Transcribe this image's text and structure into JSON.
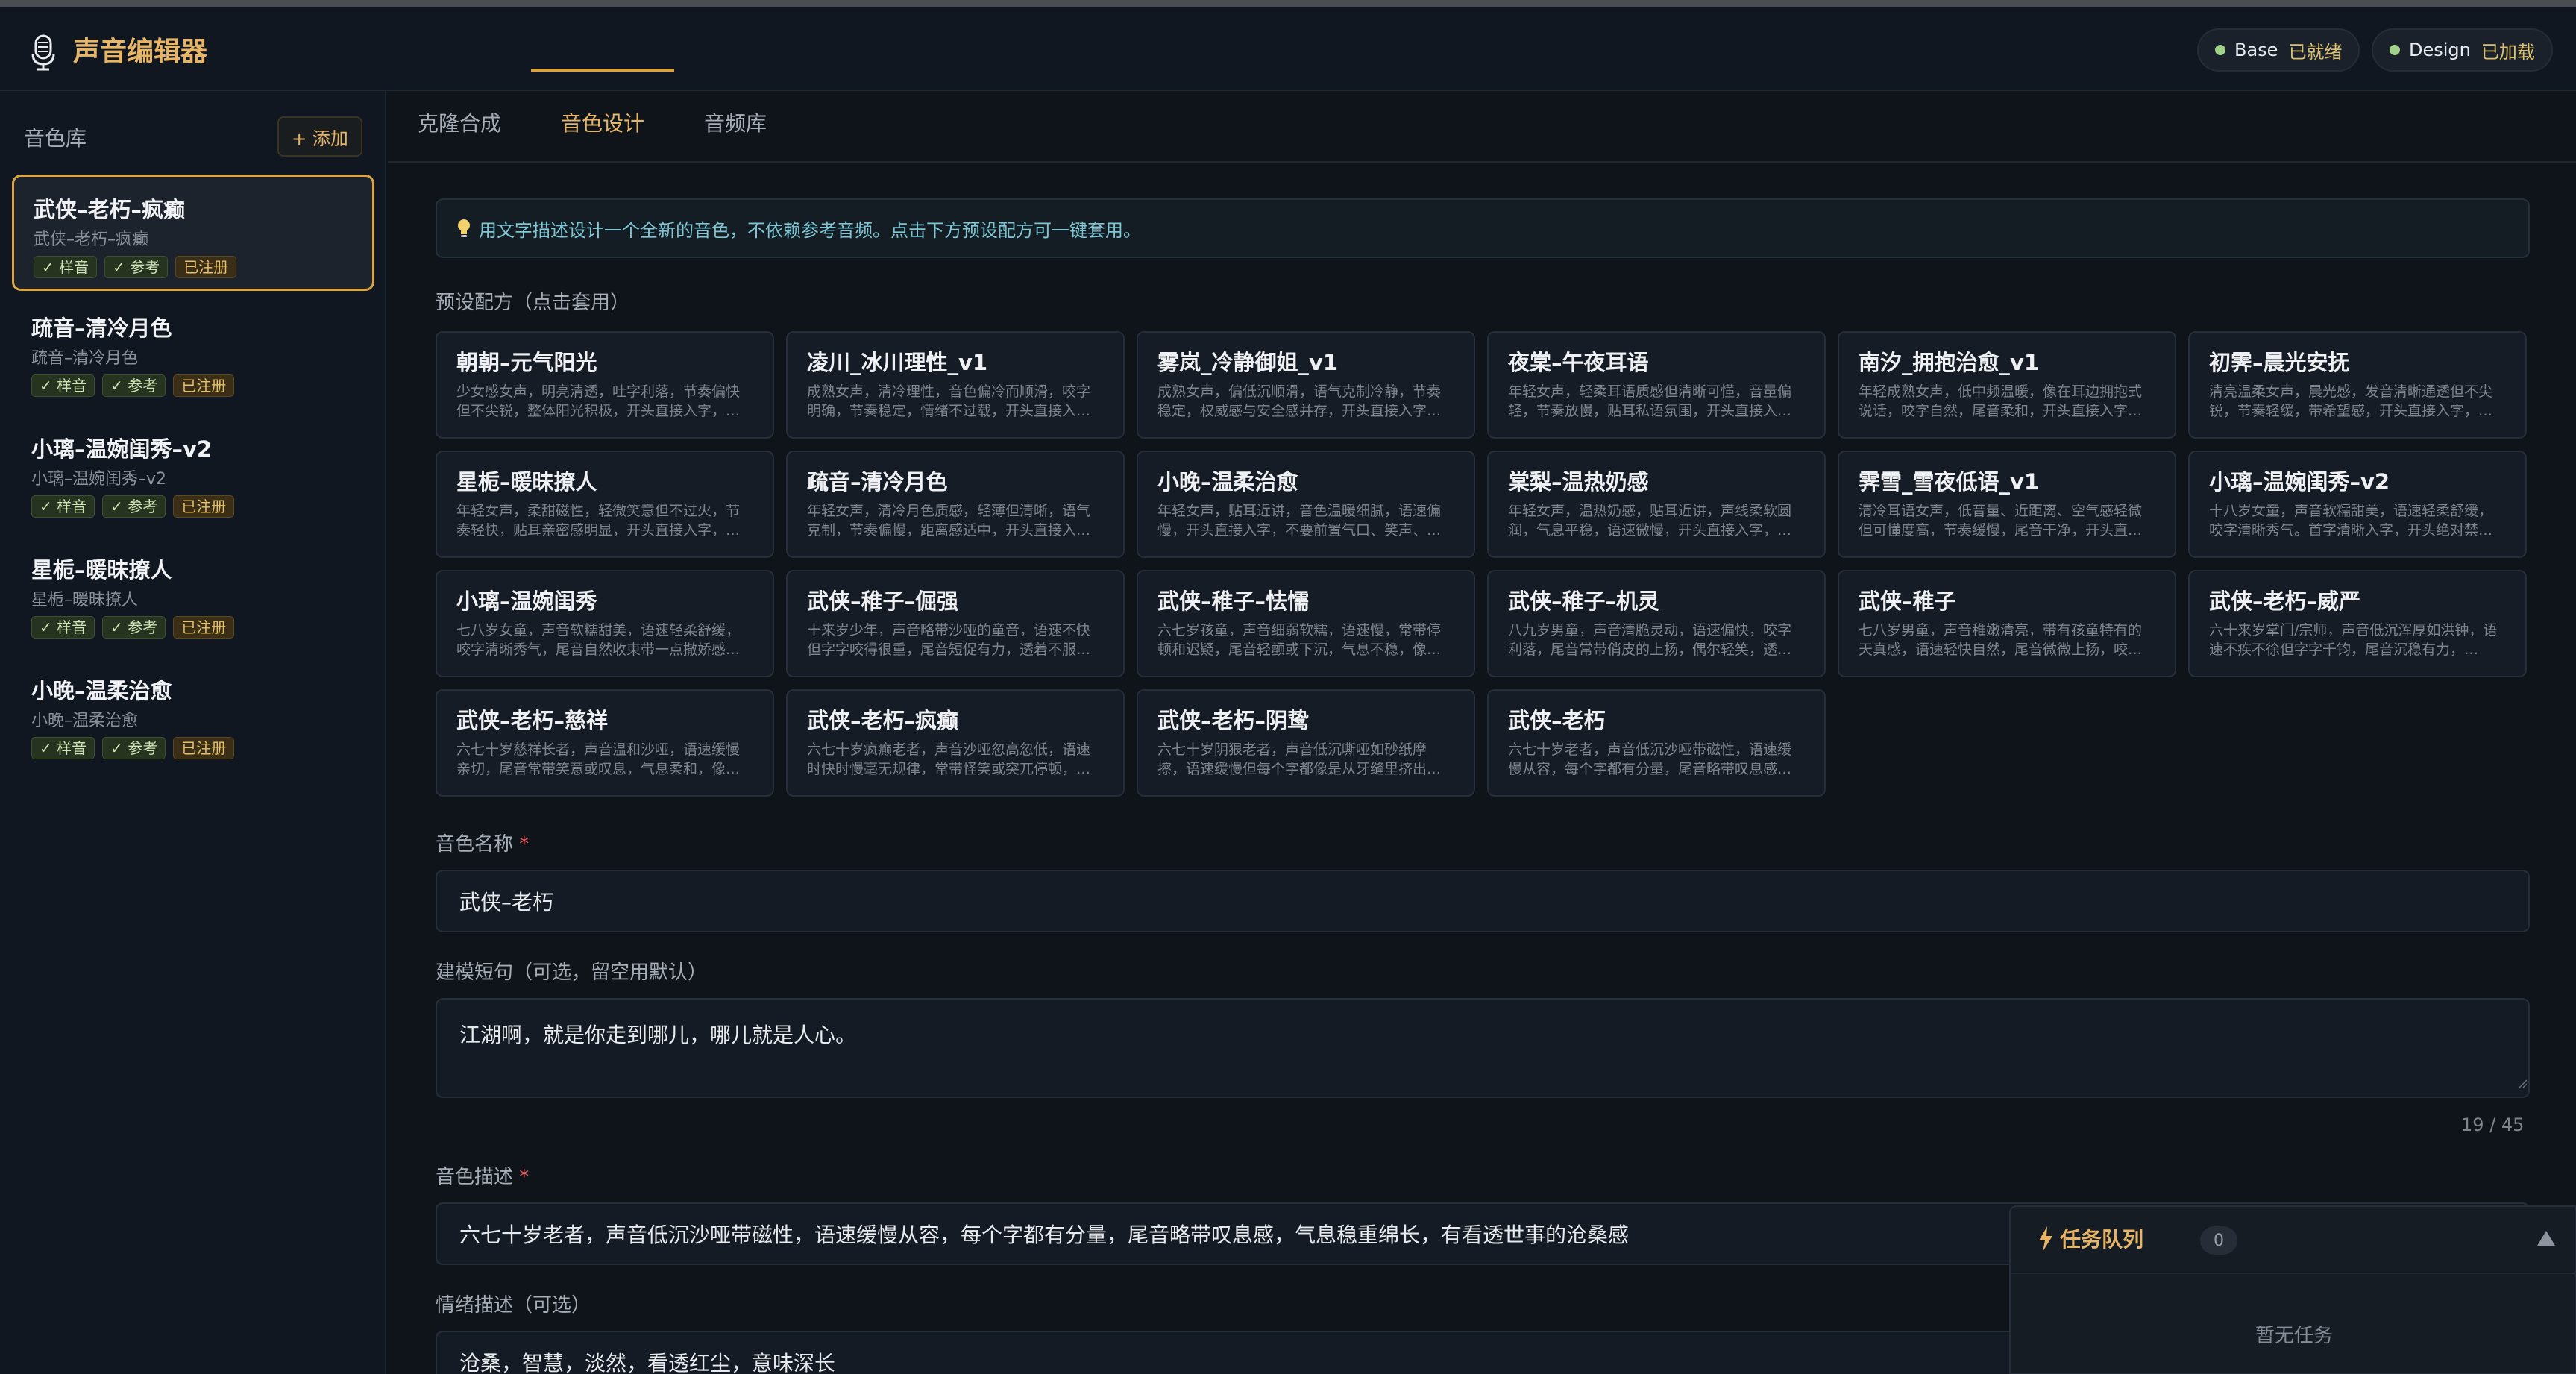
{
  "app": {
    "title": "声音编辑器",
    "icon": "microphone-icon"
  },
  "status": [
    {
      "name": "Base",
      "state": "已就绪"
    },
    {
      "name": "Design",
      "state": "已加载"
    }
  ],
  "sidebar": {
    "title": "音色库",
    "add_label": "+ 添加",
    "items": [
      {
        "name": "武侠–老朽–疯癫",
        "sub": "武侠–老朽–疯癫",
        "tags": [
          "✓ 样音",
          "✓ 参考",
          "已注册"
        ],
        "active": true
      },
      {
        "name": "疏音–清冷月色",
        "sub": "疏音–清冷月色",
        "tags": [
          "✓ 样音",
          "✓ 参考",
          "已注册"
        ]
      },
      {
        "name": "小璃–温婉闺秀–v2",
        "sub": "小璃–温婉闺秀–v2",
        "tags": [
          "✓ 样音",
          "✓ 参考",
          "已注册"
        ]
      },
      {
        "name": "星栀–暖昧撩人",
        "sub": "星栀–暖昧撩人",
        "tags": [
          "✓ 样音",
          "✓ 参考",
          "已注册"
        ]
      },
      {
        "name": "小晚–温柔治愈",
        "sub": "小晚–温柔治愈",
        "tags": [
          "✓ 样音",
          "✓ 参考",
          "已注册"
        ]
      }
    ]
  },
  "tabs": [
    "克隆合成",
    "音色设计",
    "音频库"
  ],
  "active_tab": "音色设计",
  "banner": "用文字描述设计一个全新的音色，不依赖参考音频。点击下方预设配方可一键套用。",
  "presets_label": "预设配方（点击套用）",
  "presets": [
    {
      "name": "朝朝–元气阳光",
      "desc": "少女感女声，明亮清透，吐字利落，节奏偏快但不尖锐，整体阳光积极，开头直接入字，…"
    },
    {
      "name": "凌川_冰川理性_v1",
      "desc": "成熟女声，清冷理性，音色偏冷而顺滑，咬字明确，节奏稳定，情绪不过载，开头直接入…"
    },
    {
      "name": "雾岚_冷静御姐_v1",
      "desc": "成熟女声，偏低沉顺滑，语气克制冷静，节奏稳定，权威感与安全感并存，开头直接入字…"
    },
    {
      "name": "夜棠–午夜耳语",
      "desc": "年轻女声，轻柔耳语质感但清晰可懂，音量偏轻，节奏放慢，贴耳私语氛围，开头直接入…"
    },
    {
      "name": "南汐_拥抱治愈_v1",
      "desc": "年轻成熟女声，低中频温暖，像在耳边拥抱式说话，咬字自然，尾音柔和，开头直接入字…"
    },
    {
      "name": "初霁–晨光安抚",
      "desc": "清亮温柔女声，晨光感，发音清晰通透但不尖锐，节奏轻缓，带希望感，开头直接入字，…"
    },
    {
      "name": "星栀–暖昧撩人",
      "desc": "年轻女声，柔甜磁性，轻微笑意但不过火，节奏轻快，贴耳亲密感明显，开头直接入字，…"
    },
    {
      "name": "疏音–清冷月色",
      "desc": "年轻女声，清冷月色质感，轻薄但清晰，语气克制，节奏偏慢，距离感适中，开头直接入…"
    },
    {
      "name": "小晚–温柔治愈",
      "desc": "年轻女声，贴耳近讲，音色温暖细腻，语速偏慢，开头直接入字，不要前置气口、笑声、…"
    },
    {
      "name": "棠梨–温热奶感",
      "desc": "年轻女声，温热奶感，贴耳近讲，声线柔软圆润，气息平稳，语速微慢，开头直接入字，…"
    },
    {
      "name": "霁雪_雪夜低语_v1",
      "desc": "清冷耳语女声，低音量、近距离、空气感轻微但可懂度高，节奏缓慢，尾音干净，开头直…"
    },
    {
      "name": "小璃–温婉闺秀–v2",
      "desc": "十八岁女童，声音软糯甜美，语速轻柔舒缓，咬字清晰秀气。首字清晰入字，开头绝对禁…"
    },
    {
      "name": "小璃–温婉闺秀",
      "desc": "七八岁女童，声音软糯甜美，语速轻柔舒缓，咬字清晰秀气，尾音自然收束带一点撒娇感…"
    },
    {
      "name": "武侠–稚子–倔强",
      "desc": "十来岁少年，声音略带沙哑的童音，语速不快但字字咬得很重，尾音短促有力，透着不服…"
    },
    {
      "name": "武侠–稚子–怯懦",
      "desc": "六七岁孩童，声音细弱软糯，语速慢，常带停顿和迟疑，尾音轻颤或下沉，气息不稳，像…"
    },
    {
      "name": "武侠–稚子–机灵",
      "desc": "八九岁男童，声音清脆灵动，语速偏快，咬字利落，尾音常带俏皮的上扬，偶尔轻笑，透…"
    },
    {
      "name": "武侠–稚子",
      "desc": "七八岁男童，声音稚嫩清亮，带有孩童特有的天真感，语速轻快自然，尾音微微上扬，咬…"
    },
    {
      "name": "武侠–老朽–威严",
      "desc": "六十来岁掌门/宗师，声音低沉浑厚如洪钟，语速不疾不徐但字字千钧，尾音沉稳有力，…"
    },
    {
      "name": "武侠–老朽–慈祥",
      "desc": "六七十岁慈祥长者，声音温和沙哑，语速缓慢亲切，尾音常带笑意或叹息，气息柔和，像…"
    },
    {
      "name": "武侠–老朽–疯癫",
      "desc": "六七十岁疯癫老者，声音沙哑忽高忽低，语速时快时慢毫无规律，常带怪笑或突兀停顿，…"
    },
    {
      "name": "武侠–老朽–阴鸷",
      "desc": "六七十岁阴狠老者，声音低沉嘶哑如砂纸摩擦，语速缓慢但每个字都像是从牙缝里挤出…"
    },
    {
      "name": "武侠–老朽",
      "desc": "六七十岁老者，声音低沉沙哑带磁性，语速缓慢从容，每个字都有分量，尾音略带叹息感…"
    }
  ],
  "form": {
    "name_label": "音色名称",
    "name_value": "武侠–老朽",
    "sentence_label": "建模短句（可选，留空用默认）",
    "sentence_value": "江湖啊，就是你走到哪儿，哪儿就是人心。",
    "counter": "19 / 45",
    "desc_label": "音色描述",
    "desc_value": "六七十岁老者，声音低沉沙哑带磁性，语速缓慢从容，每个字都有分量，尾音略带叹息感，气息稳重绵长，有看透世事的沧桑感",
    "emotion_label": "情绪描述（可选）",
    "emotion_value": "沧桑，智慧，淡然，看透红尘，意味深长"
  },
  "queue": {
    "title": "任务队列",
    "count": "0",
    "empty": "暂无任务"
  },
  "colors": {
    "accent": "#e6b567",
    "background": "#0f141b",
    "status_ok": "#9fd18a"
  }
}
